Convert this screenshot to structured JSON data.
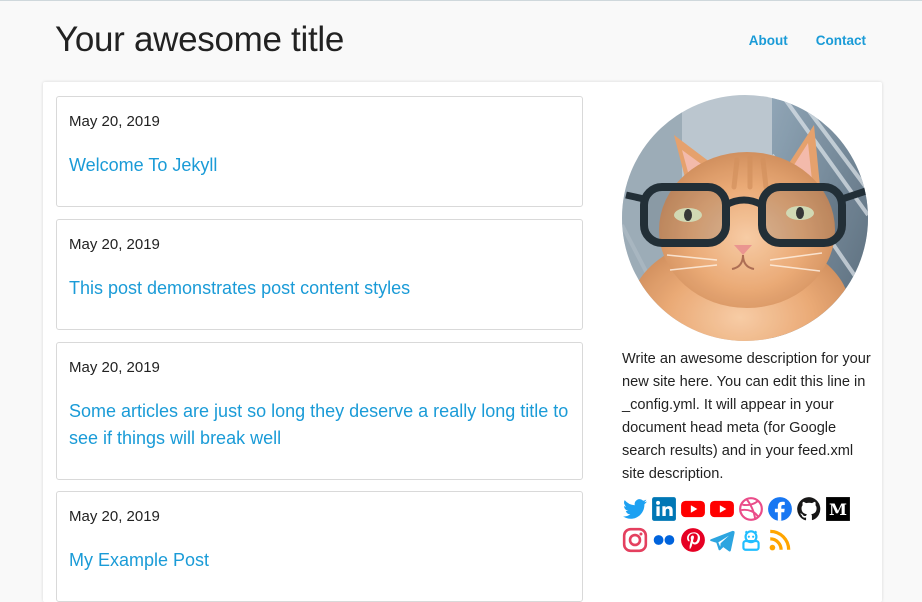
{
  "header": {
    "site_title": "Your awesome title",
    "nav": [
      {
        "label": "About"
      },
      {
        "label": "Contact"
      }
    ]
  },
  "posts": [
    {
      "date": "May 20, 2019",
      "title": "Welcome To Jekyll"
    },
    {
      "date": "May 20, 2019",
      "title": "This post demonstrates post content styles"
    },
    {
      "date": "May 20, 2019",
      "title": "Some articles are just so long they deserve a really long title to see if things will break well"
    },
    {
      "date": "May 20, 2019",
      "title": "My Example Post"
    }
  ],
  "sidebar": {
    "avatar": "cat-with-glasses-avatar",
    "description": "Write an awesome description for your new site here. You can edit this line in _config.yml. It will appear in your document head meta (for Google search results) and in your feed.xml site description.",
    "social_icons": [
      {
        "name": "twitter-icon",
        "color": "#1da1f2"
      },
      {
        "name": "linkedin-icon",
        "color": "#0077b5"
      },
      {
        "name": "youtube-icon",
        "color": "#ff0000"
      },
      {
        "name": "youtube-icon",
        "color": "#ff0000"
      },
      {
        "name": "dribbble-icon",
        "color": "#ea4c89"
      },
      {
        "name": "facebook-icon",
        "color": "#1877f2"
      },
      {
        "name": "github-icon",
        "color": "#181717"
      },
      {
        "name": "medium-icon",
        "color": "#000000"
      },
      {
        "name": "instagram-icon",
        "color": "#e4405f"
      },
      {
        "name": "flickr-icon",
        "color": "#0063dc"
      },
      {
        "name": "pinterest-icon",
        "color": "#e60023"
      },
      {
        "name": "telegram-icon",
        "color": "#2ca5e0"
      },
      {
        "name": "kaggle-icon",
        "color": "#20beff"
      },
      {
        "name": "rss-icon",
        "color": "#ffa500"
      }
    ]
  },
  "colors": {
    "link": "#1a9bd7",
    "background": "#f9f9f9"
  }
}
